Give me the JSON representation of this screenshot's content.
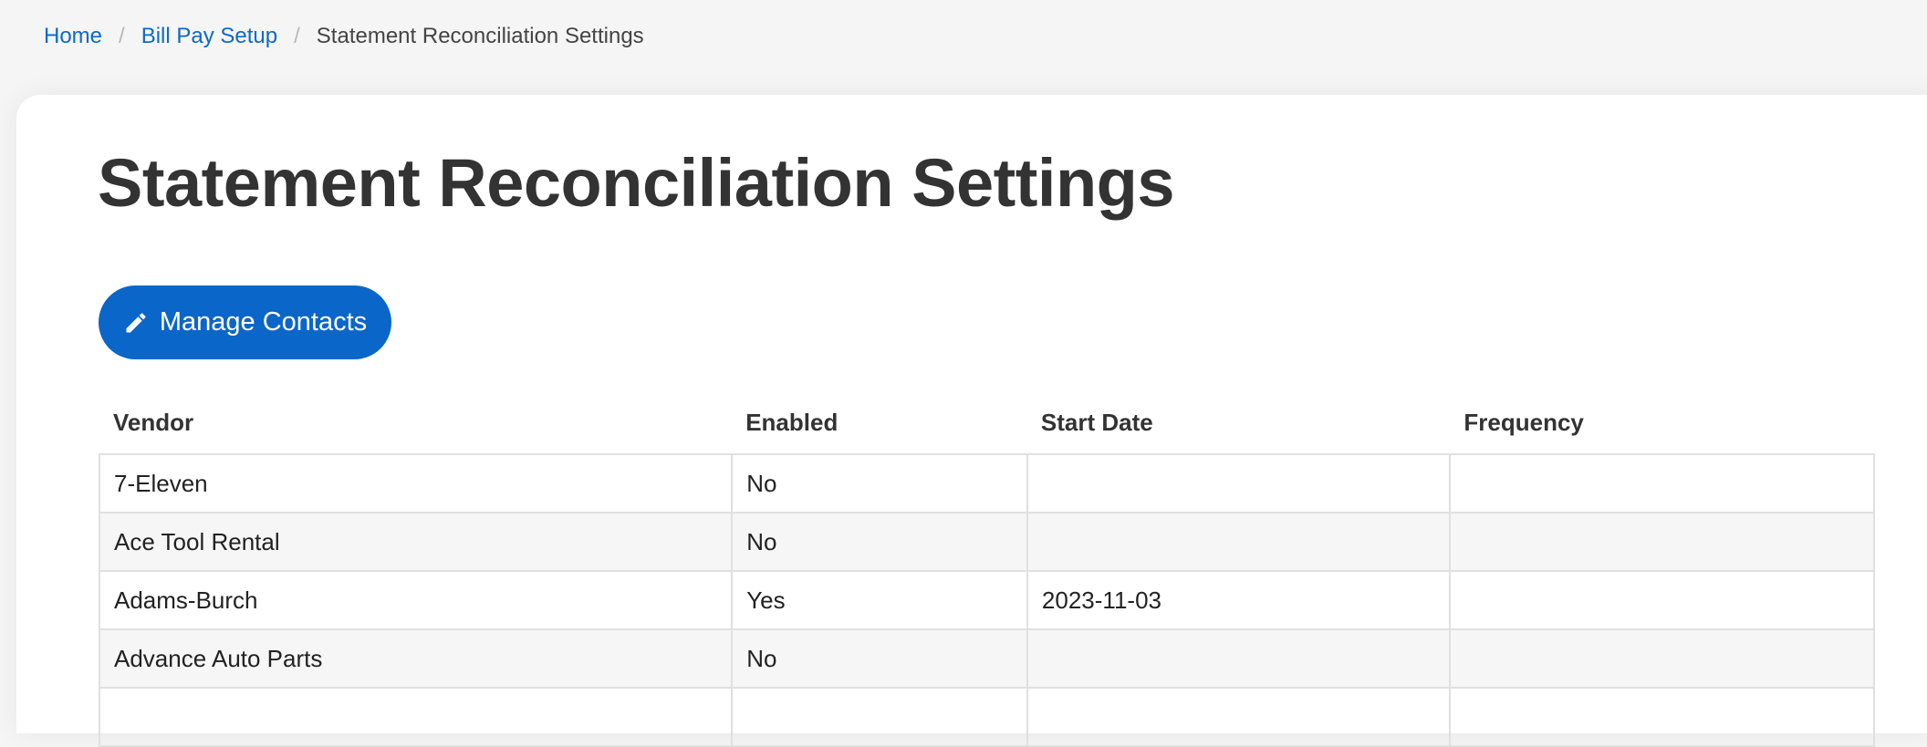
{
  "breadcrumb": {
    "home": "Home",
    "bill_pay": "Bill Pay Setup",
    "current": "Statement Reconciliation Settings",
    "separator": "/"
  },
  "page": {
    "title": "Statement Reconciliation Settings"
  },
  "actions": {
    "manage_contacts": "Manage Contacts",
    "manage_contacts_icon": "pencil-icon"
  },
  "table": {
    "headers": [
      "Vendor",
      "Enabled",
      "Start Date",
      "Frequency"
    ],
    "rows": [
      {
        "vendor": "7-Eleven",
        "enabled": "No",
        "start_date": "",
        "frequency": ""
      },
      {
        "vendor": "Ace Tool Rental",
        "enabled": "No",
        "start_date": "",
        "frequency": ""
      },
      {
        "vendor": "Adams-Burch",
        "enabled": "Yes",
        "start_date": "2023-11-03",
        "frequency": ""
      },
      {
        "vendor": "Advance Auto Parts",
        "enabled": "No",
        "start_date": "",
        "frequency": ""
      },
      {
        "vendor": "",
        "enabled": "",
        "start_date": "",
        "frequency": ""
      }
    ]
  },
  "colors": {
    "accent": "#0a66c8",
    "link": "#0a6ac9",
    "background": "#f5f5f6"
  }
}
